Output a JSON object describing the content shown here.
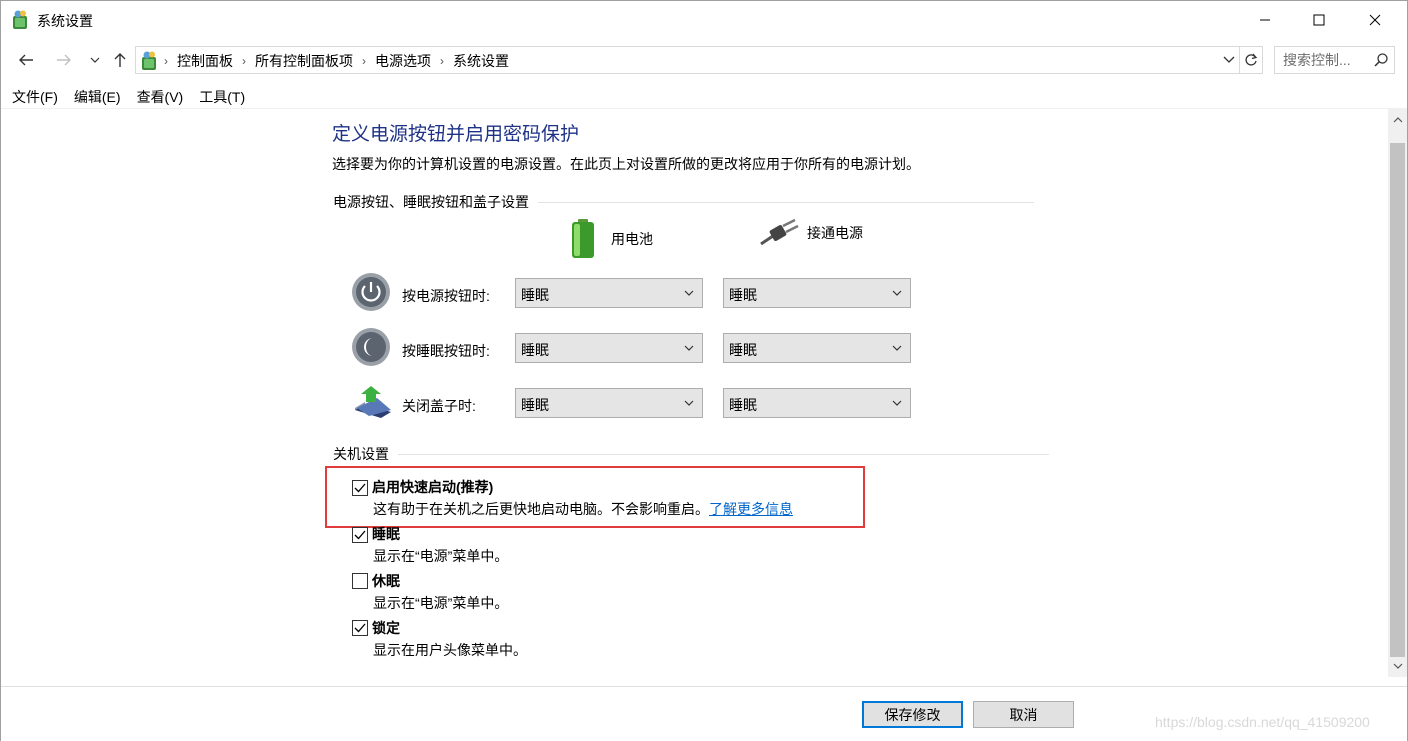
{
  "window": {
    "title": "系统设置",
    "icon": "control-panel-icon"
  },
  "address_bar": {
    "breadcrumbs": [
      "控制面板",
      "所有控制面板项",
      "电源选项",
      "系统设置"
    ],
    "search_placeholder": "搜索控制..."
  },
  "menu": [
    "文件(F)",
    "编辑(E)",
    "查看(V)",
    "工具(T)"
  ],
  "page": {
    "heading": "定义电源按钮并启用密码保护",
    "description": "选择要为你的计算机设置的电源设置。在此页上对设置所做的更改将应用于你所有的电源计划。",
    "section_buttons": "电源按钮、睡眠按钮和盖子设置",
    "col_battery": "用电池",
    "col_plugged": "接通电源",
    "rows": [
      {
        "label": "按电源按钮时:",
        "icon": "power-button-icon",
        "battery": "睡眠",
        "plugged": "睡眠"
      },
      {
        "label": "按睡眠按钮时:",
        "icon": "sleep-button-icon",
        "battery": "睡眠",
        "plugged": "睡眠"
      },
      {
        "label": "关闭盖子时:",
        "icon": "laptop-lid-icon",
        "battery": "睡眠",
        "plugged": "睡眠"
      }
    ],
    "section_shutdown": "关机设置",
    "options": [
      {
        "title": "启用快速启动(推荐)",
        "desc": "这有助于在关机之后更快地启动电脑。不会影响重启。",
        "link": "了解更多信息",
        "checked": true
      },
      {
        "title": "睡眠",
        "desc": "显示在“电源”菜单中。",
        "checked": true
      },
      {
        "title": "休眠",
        "desc": "显示在“电源”菜单中。",
        "checked": false
      },
      {
        "title": "锁定",
        "desc": "显示在用户头像菜单中。",
        "checked": true
      }
    ]
  },
  "footer": {
    "save": "保存修改",
    "cancel": "取消",
    "watermark": "https://blog.csdn.net/qq_41509200"
  },
  "colors": {
    "heading": "#1e3287",
    "link": "#0066cc",
    "highlight": "#e03c3c",
    "primary_border": "#0078d7"
  }
}
